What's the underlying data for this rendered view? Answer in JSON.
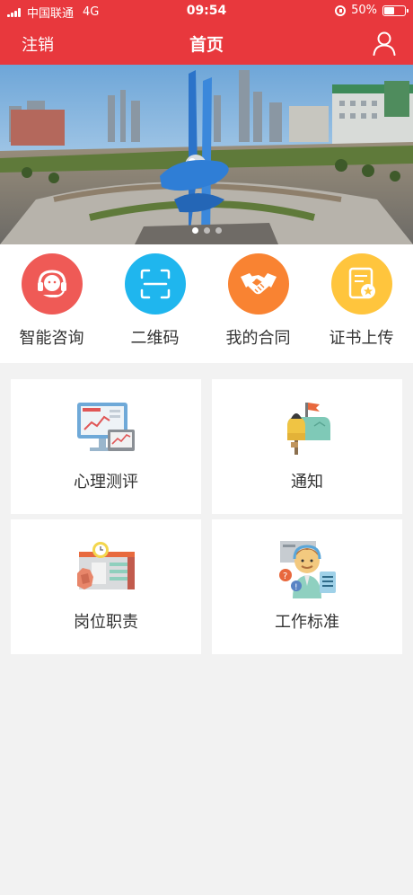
{
  "status_bar": {
    "carrier": "中国联通",
    "network": "4G",
    "time": "09:54",
    "battery_text": "50%",
    "battery_level": 0.5
  },
  "nav": {
    "left_label": "注销",
    "title": "首页",
    "right_icon": "user-icon"
  },
  "banner": {
    "slide_count": 3,
    "active_index": 0
  },
  "quick_actions": [
    {
      "label": "智能咨询",
      "icon": "headset-icon",
      "color": "#ef5a56"
    },
    {
      "label": "二维码",
      "icon": "qr-scan-icon",
      "color": "#1fb6ee"
    },
    {
      "label": "我的合同",
      "icon": "handshake-icon",
      "color": "#f98332"
    },
    {
      "label": "证书上传",
      "icon": "certificate-icon",
      "color": "#ffc53d"
    }
  ],
  "cards": [
    {
      "label": "心理测评",
      "icon": "monitor-chart-icon"
    },
    {
      "label": "通知",
      "icon": "mailbox-icon"
    },
    {
      "label": "岗位职责",
      "icon": "calendar-board-icon"
    },
    {
      "label": "工作标准",
      "icon": "support-agent-icon"
    }
  ],
  "colors": {
    "brand": "#e8383d",
    "page_bg": "#f2f2f2"
  }
}
